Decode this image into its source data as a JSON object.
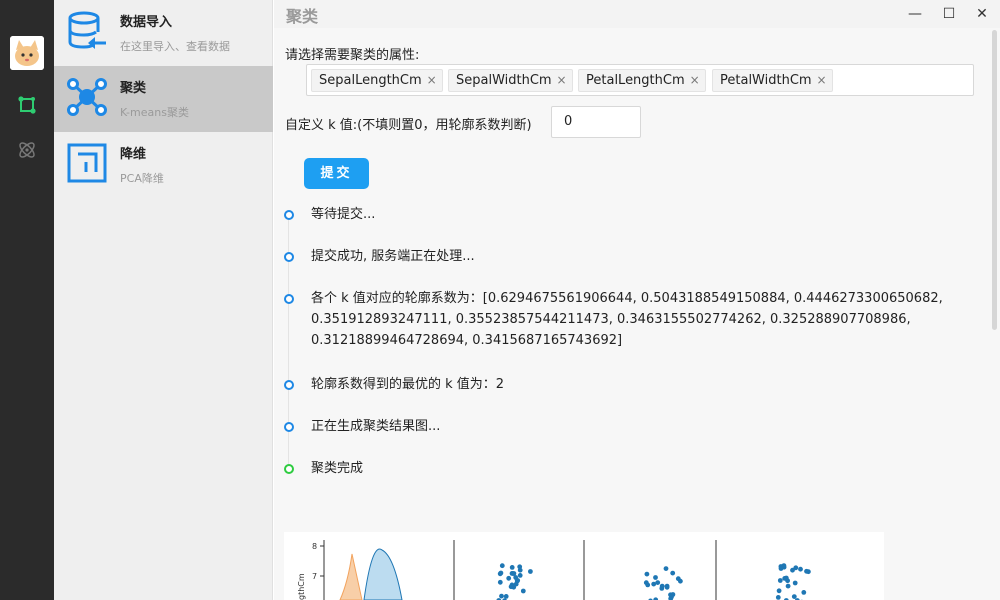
{
  "rail": {
    "icons": [
      "avatar",
      "cluster-icon",
      "atom-icon"
    ]
  },
  "nav": {
    "items": [
      {
        "title": "数据导入",
        "subtitle": "在这里导入、查看数据",
        "icon": "database-import-icon"
      },
      {
        "title": "聚类",
        "subtitle": "K-means聚类",
        "icon": "cluster-nodes-icon"
      },
      {
        "title": "降维",
        "subtitle": "PCA降维",
        "icon": "dimension-reduce-icon"
      }
    ],
    "active_index": 1
  },
  "header": {
    "title": "聚类",
    "minimize": "—",
    "maximize": "☐",
    "close": "✕"
  },
  "form": {
    "attributes_label": "请选择需要聚类的属性:",
    "tags": [
      "SepalLengthCm",
      "SepalWidthCm",
      "PetalLengthCm",
      "PetalWidthCm"
    ],
    "tag_remove": "×",
    "k_label": "自定义 k 值:(不填则置0，用轮廓系数判断)",
    "k_value": "0",
    "submit_label": "提交"
  },
  "timeline": [
    {
      "text": "等待提交...",
      "status": "pending"
    },
    {
      "text": "提交成功, 服务端正在处理...",
      "status": "pending"
    },
    {
      "text": "各个 k 值对应的轮廓系数为：[0.6294675561906644, 0.5043188549150884, 0.4446273300650682, 0.351912893247111, 0.35523857544211473, 0.3463155502774262, 0.325288907708986, 0.31218899464728694, 0.3415687165743692]",
      "status": "pending"
    },
    {
      "text": "轮廓系数得到的最优的 k 值为：2",
      "status": "pending"
    },
    {
      "text": "正在生成聚类结果图...",
      "status": "pending"
    },
    {
      "text": "聚类完成",
      "status": "done"
    }
  ],
  "plot": {
    "ytick_8": "8",
    "ytick_7": "7",
    "ylabel_fragment": "gthCm"
  },
  "colors": {
    "accent": "#1e9ff2",
    "timeline_pending": "#1e88e5",
    "timeline_done": "#2ecc40",
    "kde_orange": "#f2a35e",
    "kde_blue": "#7fb8dc",
    "scatter_blue": "#1f77b4"
  }
}
